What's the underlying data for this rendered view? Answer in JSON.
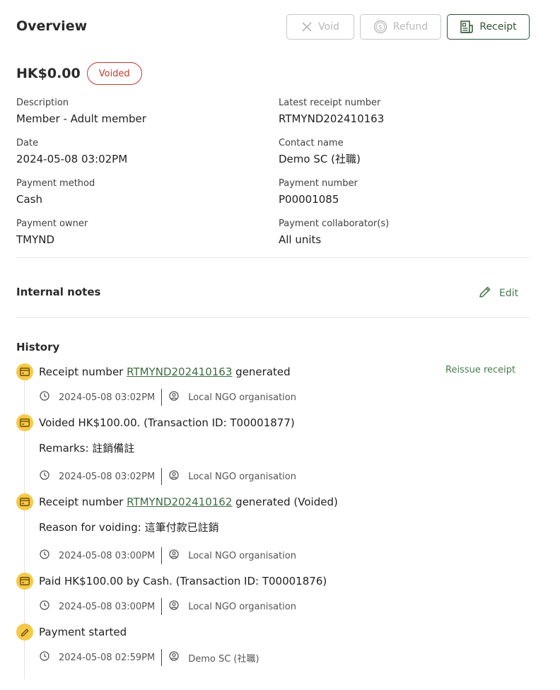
{
  "header": {
    "title": "Overview",
    "void_label": "Void",
    "refund_label": "Refund",
    "receipt_label": "Receipt"
  },
  "summary": {
    "amount": "HK$0.00",
    "status": "Voided"
  },
  "details": {
    "description_label": "Description",
    "description": "Member - Adult member",
    "latest_receipt_label": "Latest receipt number",
    "latest_receipt": "RTMYND202410163",
    "date_label": "Date",
    "date": "2024-05-08 03:02PM",
    "contact_label": "Contact name",
    "contact": "Demo SC (社職)",
    "method_label": "Payment method",
    "method": "Cash",
    "payment_number_label": "Payment number",
    "payment_number": "P00001085",
    "owner_label": "Payment owner",
    "owner": "TMYND",
    "collaborators_label": "Payment collaborator(s)",
    "collaborators": "All units"
  },
  "notes": {
    "title": "Internal notes",
    "edit_label": "Edit"
  },
  "history": {
    "title": "History",
    "reissue_label": "Reissue receipt",
    "items": [
      {
        "prefix": "Receipt number",
        "link": "RTMYND202410163",
        "suffix": "generated",
        "time": "2024-05-08 03:02PM",
        "by": "Local NGO organisation",
        "icon": "card-icon"
      },
      {
        "text": "Voided HK$100.00. (Transaction ID: T00001877)",
        "sub": "Remarks: 註銷備註",
        "time": "2024-05-08 03:02PM",
        "by": "Local NGO organisation",
        "icon": "card-icon"
      },
      {
        "prefix": "Receipt number",
        "link": "RTMYND202410162",
        "suffix": "generated (Voided)",
        "sub": "Reason for voiding: 這筆付款已註銷",
        "time": "2024-05-08 03:00PM",
        "by": "Local NGO organisation",
        "icon": "card-icon"
      },
      {
        "text": "Paid HK$100.00 by Cash. (Transaction ID: T00001876)",
        "time": "2024-05-08 03:00PM",
        "by": "Local NGO organisation",
        "icon": "card-icon"
      },
      {
        "text": "Payment started",
        "time": "2024-05-08 02:59PM",
        "by": "Demo SC (社職)",
        "icon": "pencil-icon"
      }
    ]
  },
  "colors": {
    "accent": "#2f5233",
    "status_voided": "#c0392b",
    "history_icon_bg": "#f7c948"
  }
}
